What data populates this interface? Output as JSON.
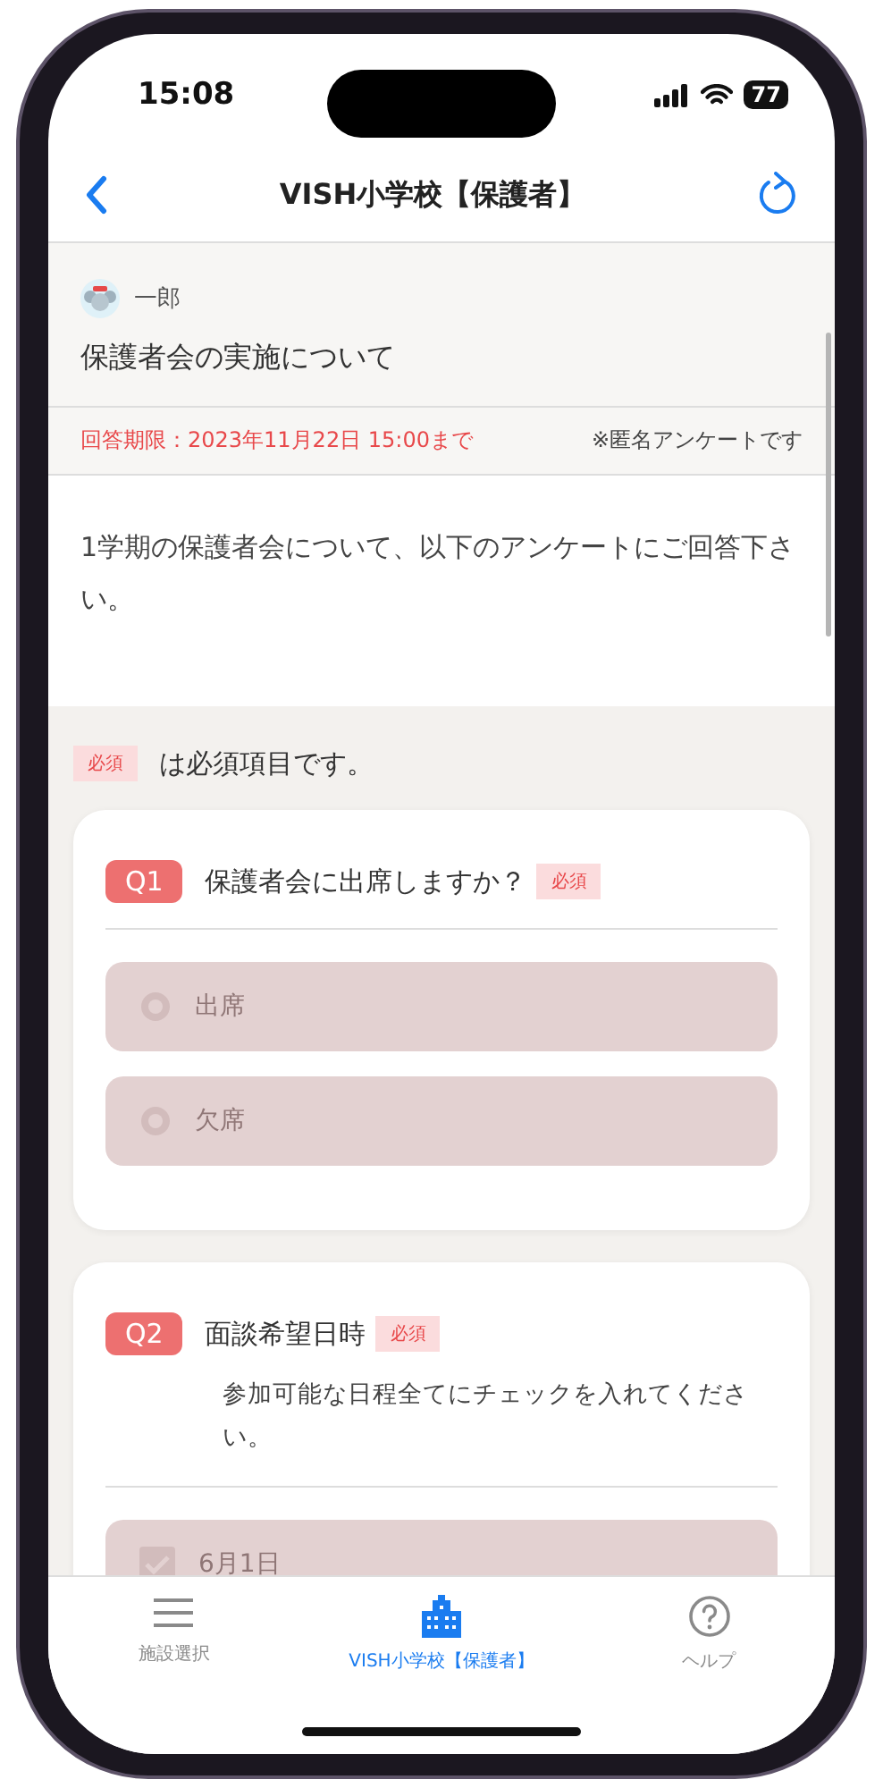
{
  "status_bar": {
    "time": "15:08",
    "battery": "77"
  },
  "nav": {
    "title": "VISH小学校【保護者】"
  },
  "survey": {
    "sender": "一郎",
    "title": "保護者会の実施について",
    "deadline": "回答期限：2023年11月22日 15:00まで",
    "anonymous_note": "※匿名アンケートです",
    "description": "1学期の保護者会について、以下のアンケートにご回答下さい。"
  },
  "legend": {
    "badge": "必須",
    "text": "は必須項目です。"
  },
  "questions": [
    {
      "number": "Q1",
      "text": "保護者会に出席しますか？",
      "required_badge": "必須",
      "kind": "radio",
      "options": [
        {
          "label": "出席",
          "selected": false,
          "disabled": true
        },
        {
          "label": "欠席",
          "selected": false,
          "disabled": true
        }
      ]
    },
    {
      "number": "Q2",
      "text": "面談希望日時",
      "required_badge": "必須",
      "note": "参加可能な日程全てにチェックを入れてください。",
      "kind": "checkbox",
      "options": [
        {
          "label": "6月1日",
          "checked": true,
          "disabled": true
        }
      ]
    }
  ],
  "tab_bar": [
    {
      "label": "施設選択",
      "selected": false
    },
    {
      "label": "VISH小学校【保護者】",
      "selected": true
    },
    {
      "label": "ヘルプ",
      "selected": false
    }
  ]
}
